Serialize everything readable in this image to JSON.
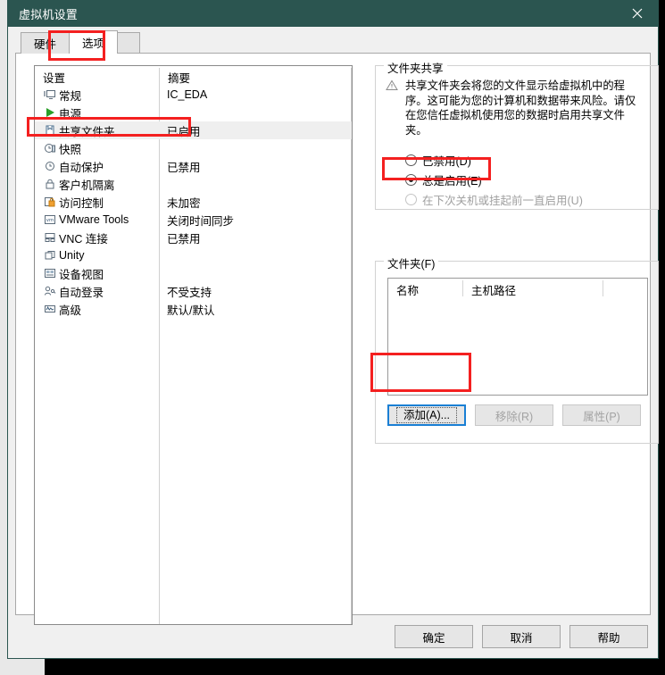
{
  "window": {
    "title": "虚拟机设置",
    "close_icon": "close-icon"
  },
  "tabs": [
    {
      "label": "硬件",
      "active": false
    },
    {
      "label": "选项",
      "active": true
    }
  ],
  "settings_list": {
    "columns": [
      "设置",
      "摘要"
    ],
    "items": [
      {
        "icon": "monitor-icon",
        "name": "常规",
        "summary": "IC_EDA",
        "selected": false
      },
      {
        "icon": "power-play-icon",
        "name": "电源",
        "summary": "",
        "selected": false
      },
      {
        "icon": "shared-folder-icon",
        "name": "共享文件夹",
        "summary": "已启用",
        "selected": true
      },
      {
        "icon": "snapshot-icon",
        "name": "快照",
        "summary": "",
        "selected": false
      },
      {
        "icon": "autoprotect-icon",
        "name": "自动保护",
        "summary": "已禁用",
        "selected": false
      },
      {
        "icon": "lock-icon",
        "name": "客户机隔离",
        "summary": "",
        "selected": false
      },
      {
        "icon": "access-control-icon",
        "name": "访问控制",
        "summary": "未加密",
        "selected": false
      },
      {
        "icon": "vmware-tools-icon",
        "name": "VMware Tools",
        "summary": "关闭时间同步",
        "selected": false
      },
      {
        "icon": "vnc-icon",
        "name": "VNC 连接",
        "summary": "已禁用",
        "selected": false
      },
      {
        "icon": "unity-icon",
        "name": "Unity",
        "summary": "",
        "selected": false
      },
      {
        "icon": "device-view-icon",
        "name": "设备视图",
        "summary": "",
        "selected": false
      },
      {
        "icon": "auto-login-icon",
        "name": "自动登录",
        "summary": "不受支持",
        "selected": false
      },
      {
        "icon": "advanced-icon",
        "name": "高级",
        "summary": "默认/默认",
        "selected": false
      }
    ]
  },
  "folder_sharing": {
    "legend": "文件夹共享",
    "warning_icon": "warning-triangle-icon",
    "warning_text": "共享文件夹会将您的文件显示给虚拟机中的程序。这可能为您的计算机和数据带来风险。请仅在您信任虚拟机使用您的数据时启用共享文件夹。",
    "options": [
      {
        "label": "已禁用(D)",
        "selected": false,
        "disabled": false
      },
      {
        "label": "总是启用(E)",
        "selected": true,
        "disabled": false
      },
      {
        "label": "在下次关机或挂起前一直启用(U)",
        "selected": false,
        "disabled": true
      }
    ]
  },
  "folders": {
    "legend": "文件夹(F)",
    "columns": [
      "名称",
      "主机路径"
    ],
    "rows": [],
    "buttons": [
      {
        "label": "添加(A)...",
        "disabled": false,
        "focused": true
      },
      {
        "label": "移除(R)",
        "disabled": true,
        "focused": false
      },
      {
        "label": "属性(P)",
        "disabled": true,
        "focused": false
      }
    ]
  },
  "footer": {
    "ok": "确定",
    "cancel": "取消",
    "help": "帮助"
  },
  "annotations": {
    "highlight_color": "#f42020",
    "boxes": [
      "tab-options",
      "shared-folders-row",
      "always-enabled-radio",
      "add-button"
    ]
  }
}
